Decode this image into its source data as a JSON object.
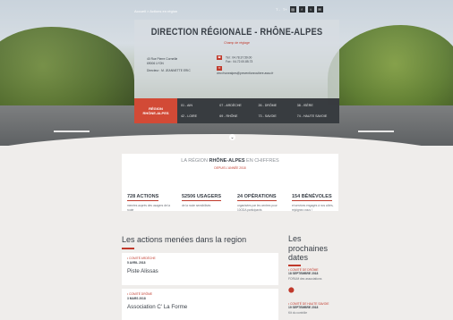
{
  "breadcrumb": {
    "home": "Accueil",
    "sep": ">",
    "current": "Actions en région"
  },
  "topbar": {
    "text_small": "T -",
    "text_large": "T+",
    "icons": [
      "print-icon",
      "facebook-icon",
      "twitter-icon",
      "mail-icon"
    ]
  },
  "hero": {
    "title": "DIRECTION RÉGIONALE - RHÔNE-ALPES",
    "subtitle": "Champ de réglage",
    "address_lines": [
      "40 Rue Pierre Corneille",
      "69006 LYON",
      "Directeur : M. JEANNETTE ERIC"
    ],
    "phone": "Tél : 04.78.37.59.00",
    "fax": "Fax : 04.72.00.85.73",
    "email": "drrv.rhonealpes@preventionroutiere.asso.fr"
  },
  "region_button": {
    "line1": "RÉGION",
    "line2": "RHÔNE-ALPES"
  },
  "departments": [
    "01 - AIN",
    "07 - ARDÈCHE",
    "26 - DRÔME",
    "38 - ISÈRE",
    "42 - LOIRE",
    "69 - RHÔNE",
    "73 - SAVOIE",
    "74 - HAUTE SAVOIE"
  ],
  "figures": {
    "title_pre": "LA RÉGION",
    "title_bold": "RHÔNE-ALPES",
    "title_post": "EN CHIFFRES",
    "subtitle": "DEPUIS L'ANNÉE 2018",
    "stats": [
      {
        "num": "728 ACTIONS",
        "label": "menées auprès des usagers de la route"
      },
      {
        "num": "52506 USAGERS",
        "label": "de la route sensibilisés"
      },
      {
        "num": "24 OPÉRATIONS",
        "label": "organisées par les centres pour 10ODA participants"
      },
      {
        "num": "154 BÉNÉVOLES",
        "label": "et services engagés à nos côtés, rejoignez-nous !"
      }
    ]
  },
  "actions": {
    "title": "Les actions menées dans la region",
    "items": [
      {
        "tag": "• COMITÉ ARDÈCHE",
        "date": "5 AVRIL 2018",
        "name": "Piste Alissas"
      },
      {
        "tag": "• COMITÉ DRÔME",
        "date": "3 MARS 2018",
        "name": "Association C' La Forme"
      }
    ]
  },
  "next": {
    "title": "Les prochaines dates",
    "events": [
      {
        "tag": "• COMITÉ DE DRÔME",
        "date": "18 SEPTEMBRE 2018",
        "info": "FORUM des associations"
      },
      {
        "tag": "• COMITÉ DE HAUTE SAVOIE",
        "date": "19 SEPTEMBRE 2018",
        "info": "Kit du contrôle"
      }
    ]
  }
}
